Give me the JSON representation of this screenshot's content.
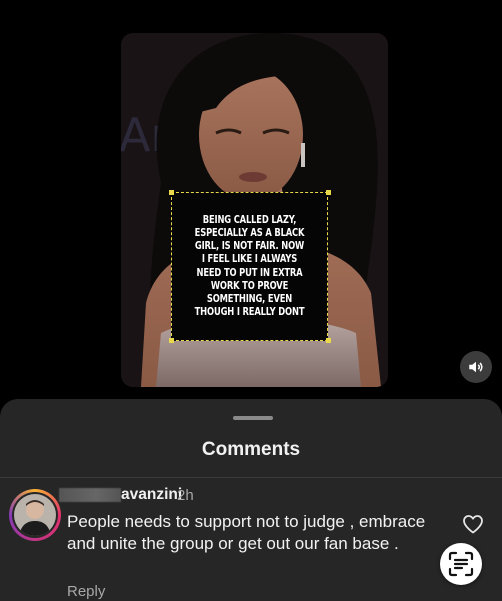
{
  "video": {
    "caption": "BEING CALLED LAZY,\nESPECIALLY AS A BLACK\nGIRL, IS NOT FAIR. NOW\nI FEEL LIKE I ALWAYS\nNEED TO PUT IN EXTRA\nWORK TO PROVE\nSOMETHING, EVEN\nTHOUGH I REALLY DONT",
    "sound_icon": "speaker-icon",
    "caption_border_color": "#e8d84a"
  },
  "comments_sheet": {
    "title": "Comments",
    "background": "#262626",
    "comments": [
      {
        "username": "avanzini",
        "time": "2h",
        "text": "People needs to support not to judge , embrace and unite the group or get out our fan base .",
        "reply_label": "Reply",
        "like_icon": "heart-icon"
      }
    ]
  },
  "floating_button": {
    "icon": "text-scan-icon"
  }
}
